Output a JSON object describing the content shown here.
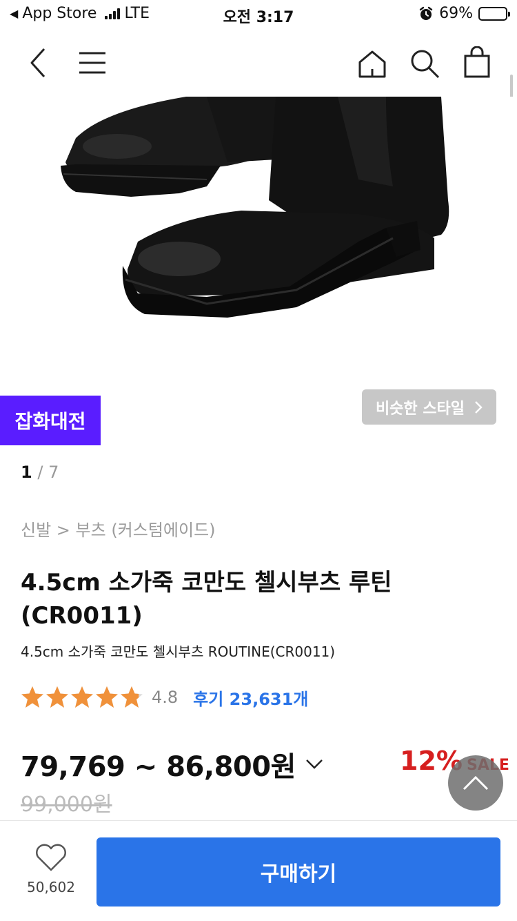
{
  "status_bar": {
    "carrier": "App Store",
    "network": "LTE",
    "time": "오전 3:17",
    "battery": "69%",
    "battery_level": 0.69
  },
  "nav": {
    "icons": [
      "back-icon",
      "menu-icon",
      "home-icon",
      "search-icon",
      "shopping-bag-icon"
    ]
  },
  "product": {
    "event_badge": "잡화대전",
    "similar_style": "비슷한 스타일",
    "image_index": "1",
    "image_total": "7",
    "breadcrumb": "신발 > 부츠 (커스텀에이드)",
    "title": "4.5cm 소가죽 코만도 첼시부츠 루틴(CR0011)",
    "subtitle": "4.5cm 소가죽 코만도 첼시부츠 ROUTINE(CR0011)",
    "rating": "4.8",
    "rating_value": 4.8,
    "reviews": "후기 23,631개",
    "price_range": "79,769 ~ 86,800원",
    "original_price": "99,000원",
    "discount_pct": "12%",
    "discount_label": "SALE"
  },
  "bottom": {
    "like_count": "50,602",
    "buy_label": "구매하기"
  },
  "colors": {
    "event_badge": "#5a1dff",
    "buy_button": "#2a74e8",
    "star": "#f0913a",
    "discount": "#d61f1f"
  }
}
